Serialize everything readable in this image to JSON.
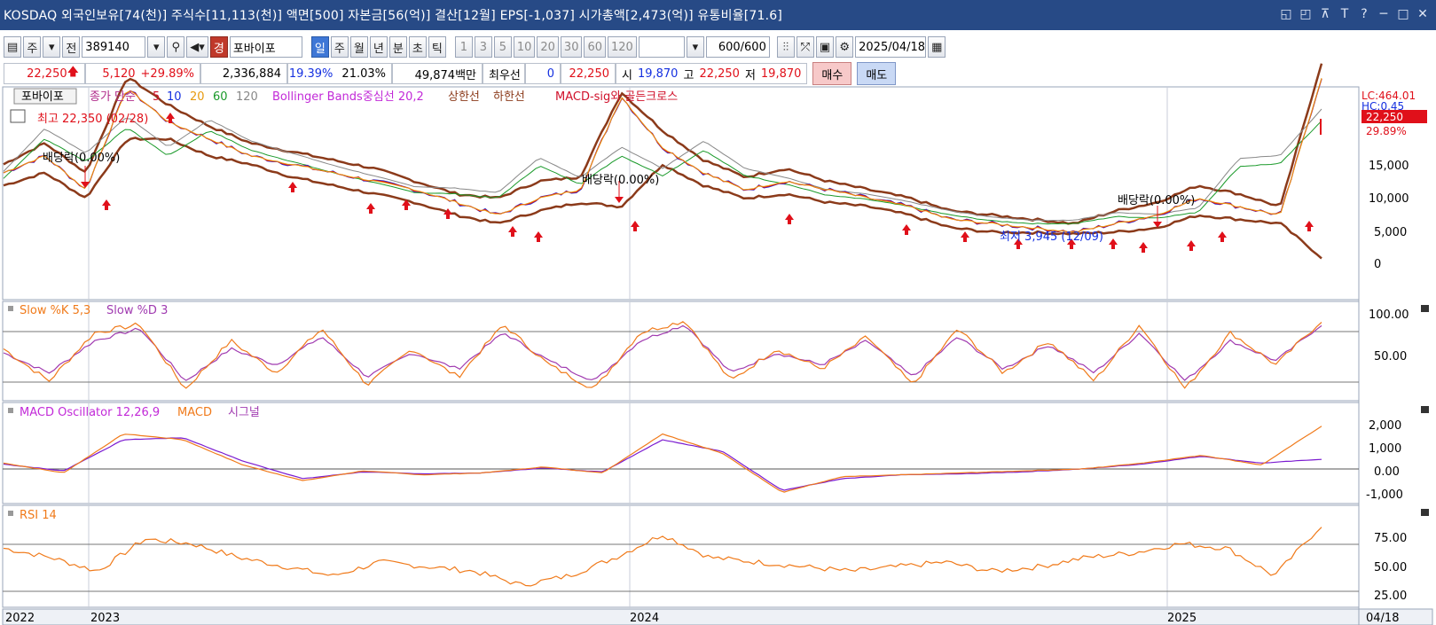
{
  "title_bar": {
    "title": "KOSDAQ 외국인보유[74(천)] 주식수[11,113(천)] 액면[500] 자본금[56(억)] 결산[12월] EPS[-1,037] 시가총액[2,473(억)] 유통비율[71.6]",
    "controls": [
      "◱",
      "◰",
      "⊼",
      "T",
      "?",
      "─",
      "□",
      "✕"
    ]
  },
  "toolbar": {
    "market_tab": "주",
    "prev_tab": "전",
    "code": "389140",
    "warning_badge": "경",
    "stock_name": "포바이포",
    "periods": [
      "일",
      "주",
      "월",
      "년",
      "분",
      "초",
      "틱"
    ],
    "active_period": "일",
    "intervals": [
      "1",
      "3",
      "5",
      "10",
      "20",
      "30",
      "60",
      "120"
    ],
    "count_value": "600",
    "count_total": "/600",
    "date": "2025/04/18"
  },
  "quote": {
    "price": "22,250",
    "change": "5,120",
    "change_pct": "+29.89%",
    "volume": "2,336,884",
    "vol_ratio": "19.39%",
    "turnover": "21.03%",
    "amount": "49,874백만",
    "best_label": "최우선",
    "best_value": "0",
    "best_price": "22,250",
    "open_label": "시",
    "open": "19,870",
    "high_label": "고",
    "high": "22,250",
    "low_label": "저",
    "low": "19,870",
    "buy_label": "매수",
    "sell_label": "매도"
  },
  "price_panel": {
    "legend": {
      "name": "포바이포",
      "ma_label": "종가 단순",
      "ma_periods": [
        "5",
        "10",
        "20",
        "60",
        "120"
      ],
      "bb": "Bollinger Bands중심선 20,2",
      "upper": "상한선",
      "lower": "하한선",
      "macd_sig": "MACD-sig와 골든크로스"
    },
    "high_annotation": "최고 22,350 (02/28)",
    "low_annotation": "최저 3,945 (12/09)",
    "dividend_label": "배당락(0.00%)",
    "right_labels": {
      "lc": "LC:464.01",
      "hc": "HC:0.45",
      "price": "22,250",
      "pct": "29.89%"
    },
    "y_ticks": [
      "15,000",
      "10,000",
      "5,000",
      "0"
    ]
  },
  "stoch_panel": {
    "k_label": "Slow %K 5,3",
    "d_label": "Slow %D 3",
    "y_ticks": [
      "100.00",
      "50.00"
    ]
  },
  "macd_panel": {
    "osc_label": "MACD Oscillator 12,26,9",
    "macd_label": "MACD",
    "signal_label": "시그널",
    "y_ticks": [
      "2,000",
      "1,000",
      "0.00",
      "-1,000"
    ]
  },
  "rsi_panel": {
    "label": "RSI 14",
    "y_ticks": [
      "75.00",
      "50.00",
      "25.00"
    ]
  },
  "x_axis": {
    "labels": [
      "2022",
      "2023",
      "2024",
      "2025"
    ],
    "last_date": "04/18"
  },
  "colors": {
    "title_bg": "#274a86",
    "price_up": "#e0101a",
    "bollinger": "#8b3a1a",
    "ma5": "#e0101a",
    "ma10": "#1530e0",
    "ma20": "#e79a10",
    "ma60": "#1a9a2a",
    "ma120": "#888888",
    "stoch_k": "#f07a1a",
    "stoch_d": "#a03ab0",
    "macd": "#f07a1a",
    "signal": "#7a1ad0",
    "rsi": "#f07a1a"
  },
  "chart_data": [
    {
      "type": "line",
      "title": "포바이포",
      "x_labels": [
        "2022",
        "2023",
        "2024",
        "2025",
        "04/18"
      ],
      "ylim": [
        0,
        18000
      ],
      "series": [
        {
          "name": "종가 단순 5",
          "values": [
            11000,
            13000,
            9000,
            21000,
            17000,
            15000,
            13000,
            12000,
            11000,
            10000,
            9000,
            7500,
            6000,
            8000,
            9000,
            20000,
            14000,
            11000,
            9000,
            10000,
            9000,
            8000,
            7000,
            5500,
            5000,
            4500,
            4000,
            5000,
            6000,
            8000,
            7000,
            6000,
            22250
          ]
        },
        {
          "name": "상한선",
          "values": [
            12000,
            14500,
            11000,
            22350,
            19000,
            16500,
            14500,
            13500,
            12500,
            11500,
            10000,
            8500,
            8000,
            10000,
            10500,
            20500,
            16000,
            12500,
            10500,
            11500,
            10000,
            9000,
            8000,
            6500,
            6000,
            5500,
            5000,
            6500,
            7500,
            9500,
            8500,
            7000,
            24000
          ]
        },
        {
          "name": "하한선",
          "values": [
            9500,
            11000,
            8000,
            15000,
            15000,
            13000,
            12000,
            10500,
            9500,
            8500,
            7500,
            6000,
            5000,
            6500,
            7500,
            7000,
            12000,
            9500,
            8000,
            8500,
            7500,
            7000,
            6000,
            4500,
            4000,
            3945,
            3800,
            4000,
            4500,
            6000,
            5500,
            5000,
            1000
          ]
        }
      ]
    },
    {
      "type": "line",
      "title": "Slow %K 5,3 / Slow %D 3",
      "ylim": [
        0,
        100
      ],
      "series": [
        {
          "name": "Slow %K 5,3",
          "values": [
            60,
            20,
            80,
            90,
            10,
            70,
            30,
            85,
            15,
            60,
            25,
            90,
            40,
            10,
            80,
            95,
            20,
            60,
            35,
            75,
            15,
            85,
            30,
            70,
            20,
            90,
            10,
            80,
            40,
            95
          ]
        },
        {
          "name": "Slow %D 3",
          "values": [
            55,
            30,
            70,
            85,
            20,
            60,
            40,
            75,
            25,
            55,
            35,
            80,
            45,
            20,
            70,
            90,
            30,
            55,
            40,
            70,
            25,
            75,
            35,
            65,
            30,
            80,
            20,
            70,
            45,
            90
          ]
        }
      ]
    },
    {
      "type": "line",
      "title": "MACD Oscillator 12,26,9",
      "ylim": [
        -1500,
        2500
      ],
      "series": [
        {
          "name": "MACD",
          "values": [
            300,
            -200,
            1800,
            1500,
            200,
            -600,
            -100,
            -300,
            -200,
            100,
            -200,
            1800,
            800,
            -1200,
            -400,
            -300,
            -200,
            -100,
            0,
            300,
            700,
            200,
            2200
          ]
        },
        {
          "name": "시그널",
          "values": [
            250,
            -100,
            1500,
            1600,
            400,
            -500,
            -150,
            -250,
            -200,
            50,
            -150,
            1500,
            900,
            -1100,
            -500,
            -300,
            -250,
            -150,
            0,
            250,
            650,
            300,
            500
          ]
        }
      ]
    },
    {
      "type": "line",
      "title": "RSI 14",
      "ylim": [
        0,
        100
      ],
      "series": [
        {
          "name": "RSI 14",
          "values": [
            65,
            55,
            40,
            75,
            70,
            55,
            45,
            35,
            50,
            45,
            40,
            25,
            35,
            55,
            80,
            55,
            50,
            45,
            40,
            45,
            50,
            40,
            45,
            55,
            60,
            70,
            65,
            35,
            90
          ]
        }
      ]
    }
  ]
}
